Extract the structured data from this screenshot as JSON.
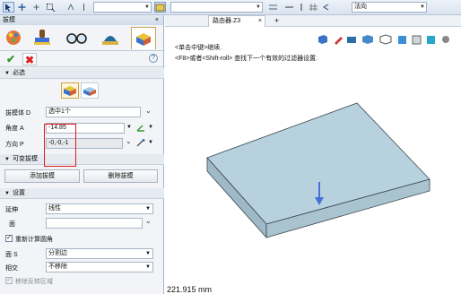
{
  "toolbar": {
    "filter_combo_value": "",
    "direction_combo_value": "法向"
  },
  "panel": {
    "title": "拔模",
    "close_glyph": "×",
    "help_glyph": "?",
    "tabs": [
      {
        "icon": "draft-faces-icon"
      },
      {
        "icon": "draft-stamp-icon"
      },
      {
        "icon": "draft-glasses-icon"
      },
      {
        "icon": "draft-body-icon"
      },
      {
        "icon": "draft-pull-icon"
      }
    ],
    "ok_glyph": "✔",
    "cancel_glyph": "✖",
    "required": {
      "title": "必选",
      "draft_body_label": "拔模体 D",
      "draft_body_value": "选中1个",
      "angle_label": "角度 A",
      "angle_value": "-14.85",
      "direction_label": "方向 P",
      "direction_value": "-0,-0,-1"
    },
    "variable": {
      "title": "可变拔模",
      "add_label": "添加拔模",
      "delete_label": "删除拔模"
    },
    "settings": {
      "title": "设置",
      "extend_label": "延伸",
      "extend_value": "线性",
      "face_label": "面",
      "face_value": "",
      "recompute_label": "重新计算圆角",
      "face_s_label": "面 S",
      "face_s_value": "分割边",
      "intersect_label": "相交",
      "intersect_value": "不移除",
      "remove_reverse_label": "移除反转区域"
    }
  },
  "doc": {
    "tab_label": "路由器.Z3",
    "tab_close": "×",
    "new_tab": "+",
    "hint_line1": "<单击中键>继续.",
    "hint_line2": "<F8>或者<Shift-roll> 查找下一个有效的过滤器设置.",
    "distance": "221.915 mm"
  },
  "colors": {
    "panel_bg": "#f2f4f7",
    "accent_border": "#e01a1a",
    "model_top": "#b6d1dd",
    "model_side": "#9fb9c5"
  }
}
